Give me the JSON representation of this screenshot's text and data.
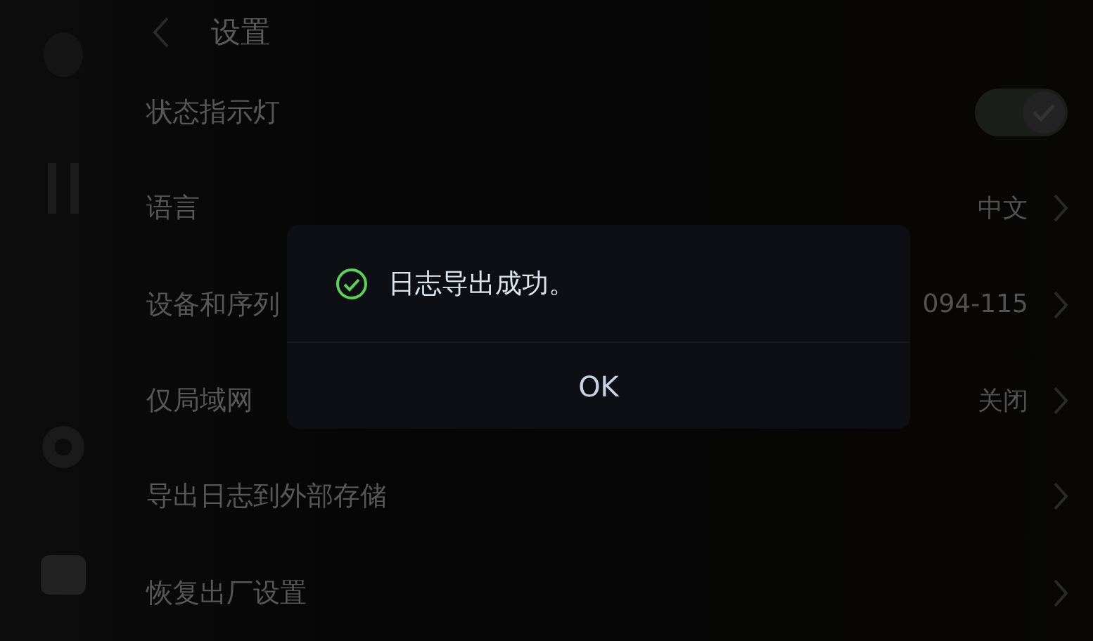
{
  "header": {
    "title": "设置"
  },
  "settings": [
    {
      "kind": "toggle",
      "label": "状态指示灯",
      "on": true
    },
    {
      "kind": "link",
      "label": "语言",
      "value": "中文"
    },
    {
      "kind": "link",
      "label": "设备和序列",
      "value": "094-115"
    },
    {
      "kind": "link",
      "label": "仅局域网",
      "value": "关闭"
    },
    {
      "kind": "link",
      "label": "导出日志到外部存储"
    },
    {
      "kind": "link",
      "label": "恢复出厂设置"
    }
  ],
  "dialog": {
    "message": "日志导出成功。",
    "button": "OK"
  }
}
